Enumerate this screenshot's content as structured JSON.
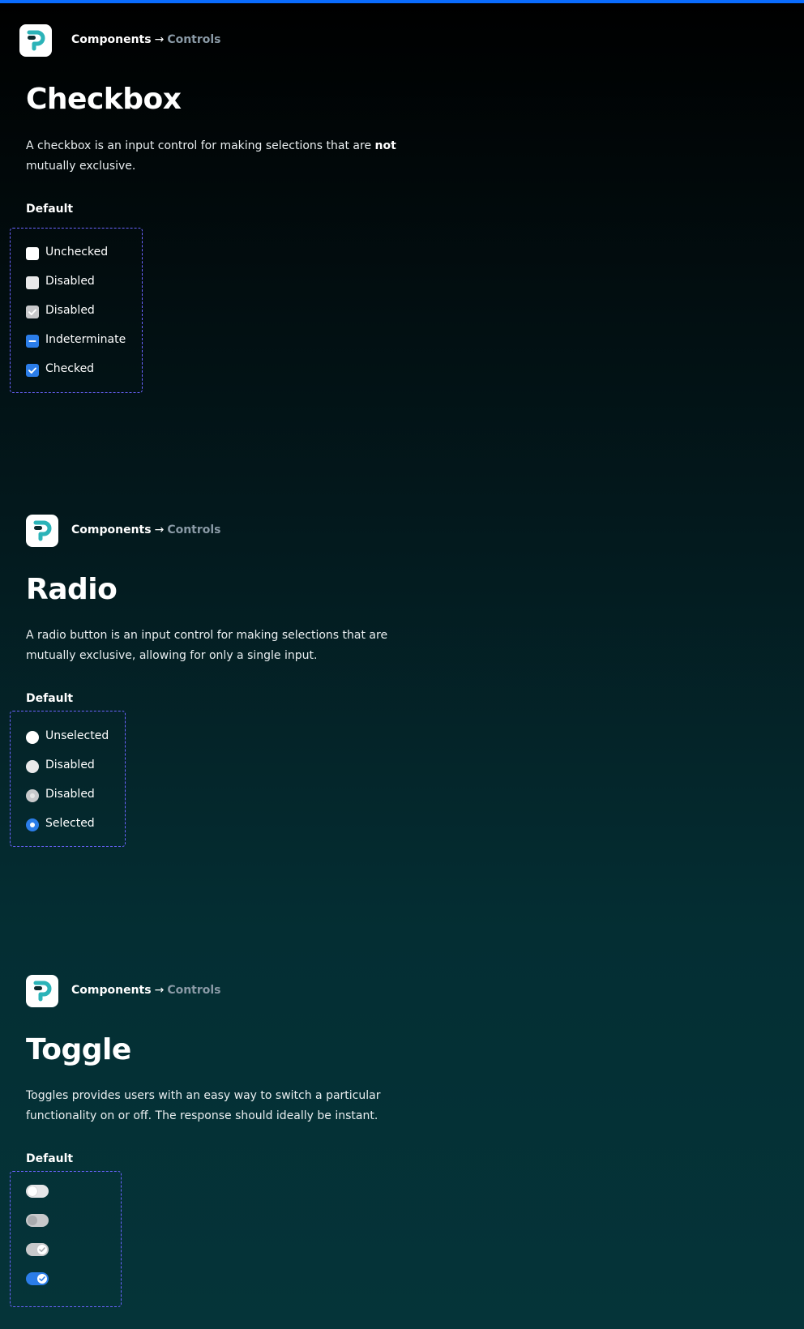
{
  "breadcrumb": {
    "parent": "Components",
    "arrow": "→",
    "current": "Controls"
  },
  "checkbox": {
    "title": "Checkbox",
    "description_before": "A checkbox is an input control for making selections that are ",
    "description_bold": "not",
    "description_after": " mutually exclusive.",
    "subtitle": "Default",
    "items": [
      {
        "label": "Unchecked",
        "state": "unchecked"
      },
      {
        "label": "Disabled",
        "state": "disabled"
      },
      {
        "label": "Disabled",
        "state": "disabled-checked"
      },
      {
        "label": "Indeterminate",
        "state": "indeterminate"
      },
      {
        "label": "Checked",
        "state": "checked"
      }
    ]
  },
  "radio": {
    "title": "Radio",
    "description": "A radio button is an input control for making selections that are mutually exclusive, allowing for only a single input.",
    "subtitle": "Default",
    "items": [
      {
        "label": "Unselected",
        "state": "unselected"
      },
      {
        "label": "Disabled",
        "state": "disabled"
      },
      {
        "label": "Disabled",
        "state": "disabled-selected"
      },
      {
        "label": "Selected",
        "state": "selected"
      }
    ]
  },
  "toggle": {
    "title": "Toggle",
    "description": "Toggles provides users with an easy way to switch a particular functionality on or off. The response should ideally be instant.",
    "subtitle": "Default",
    "items": [
      {
        "state": "off"
      },
      {
        "state": "disabled-off"
      },
      {
        "state": "disabled-on"
      },
      {
        "state": "on"
      }
    ]
  },
  "colors": {
    "accent": "#0a6cff",
    "control_blue": "#2b7de9",
    "frame_dash": "#6b63ff",
    "logo_teal": "#2bb3b8"
  }
}
